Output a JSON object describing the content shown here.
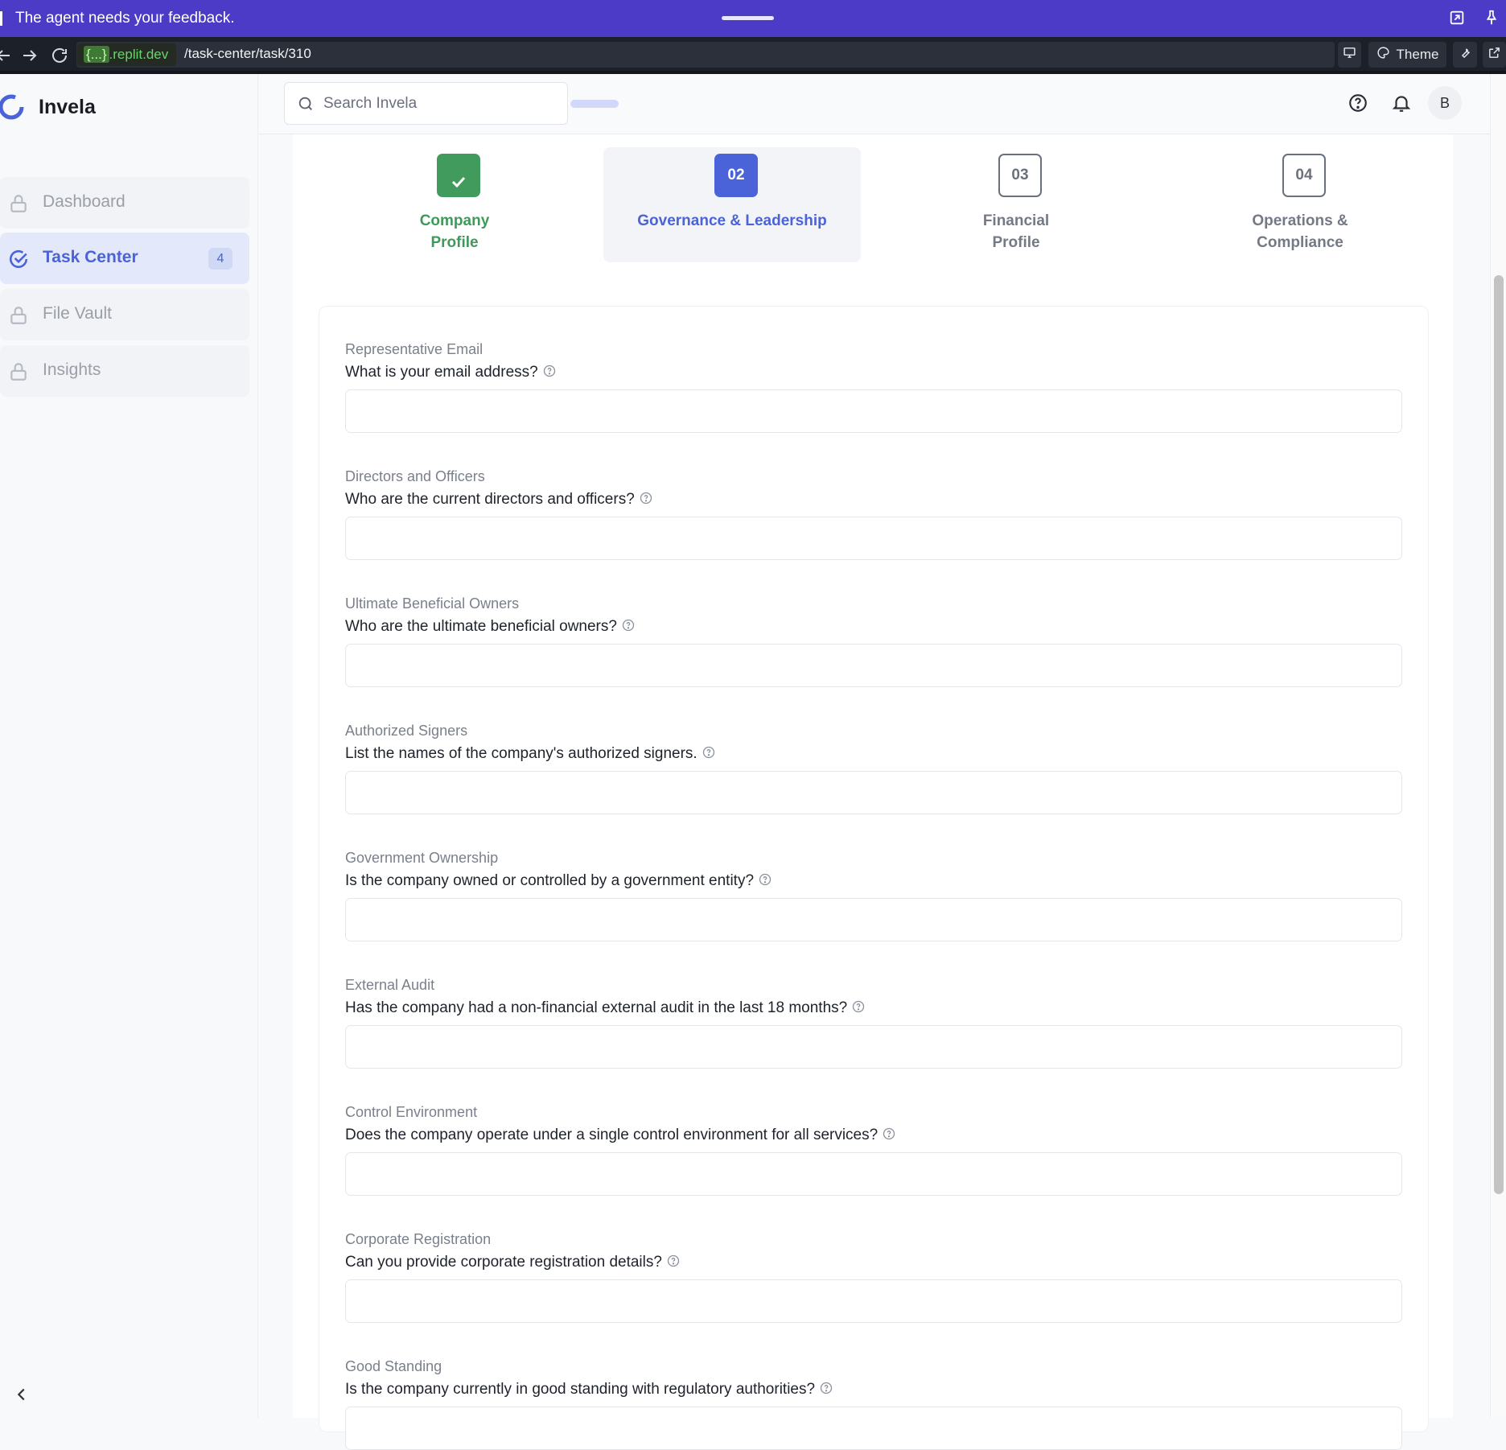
{
  "agent_bar": {
    "message": "The agent needs your feedback."
  },
  "browser": {
    "domain_brace": "{...}",
    "domain_suffix": ".replit.dev",
    "path": "/task-center/task/310",
    "theme_label": "Theme"
  },
  "sidebar": {
    "brand": "Invela",
    "items": [
      {
        "label": "Dashboard",
        "icon": "lock-icon",
        "active": false
      },
      {
        "label": "Task Center",
        "icon": "check-circle-icon",
        "active": true,
        "badge": "4"
      },
      {
        "label": "File Vault",
        "icon": "lock-icon",
        "active": false
      },
      {
        "label": "Insights",
        "icon": "lock-icon",
        "active": false
      }
    ]
  },
  "header": {
    "search_placeholder": "Search Invela",
    "avatar_initial": "B"
  },
  "steps": [
    {
      "number": "",
      "label_line1": "Company",
      "label_line2": "Profile",
      "state": "done"
    },
    {
      "number": "02",
      "label_line1": "Governance & Leadership",
      "label_line2": "",
      "state": "current"
    },
    {
      "number": "03",
      "label_line1": "Financial",
      "label_line2": "Profile",
      "state": "todo"
    },
    {
      "number": "04",
      "label_line1": "Operations &",
      "label_line2": "Compliance",
      "state": "todo"
    }
  ],
  "fields": [
    {
      "title": "Representative Email",
      "question": "What is your email address?",
      "value": ""
    },
    {
      "title": "Directors and Officers",
      "question": "Who are the current directors and officers?",
      "value": ""
    },
    {
      "title": "Ultimate Beneficial Owners",
      "question": "Who are the ultimate beneficial owners?",
      "value": ""
    },
    {
      "title": "Authorized Signers",
      "question": "List the names of the company's authorized signers.",
      "value": ""
    },
    {
      "title": "Government Ownership",
      "question": "Is the company owned or controlled by a government entity?",
      "value": ""
    },
    {
      "title": "External Audit",
      "question": "Has the company had a non-financial external audit in the last 18 months?",
      "value": ""
    },
    {
      "title": "Control Environment",
      "question": "Does the company operate under a single control environment for all services?",
      "value": ""
    },
    {
      "title": "Corporate Registration",
      "question": "Can you provide corporate registration details?",
      "value": ""
    },
    {
      "title": "Good Standing",
      "question": "Is the company currently in good standing with regulatory authorities?",
      "value": ""
    }
  ],
  "colors": {
    "agent_bar": "#4b3bc6",
    "accent": "#4a63d8",
    "success": "#409b5c"
  }
}
